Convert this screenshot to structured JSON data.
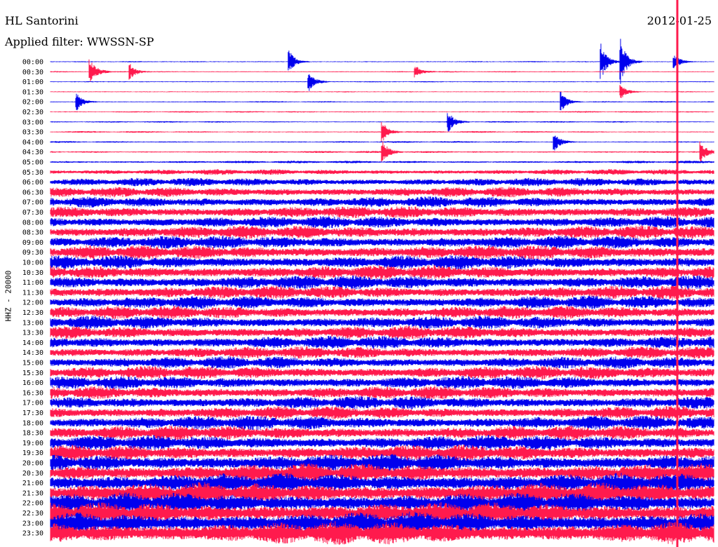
{
  "header": {
    "station": "HL Santorini",
    "filter": "Applied filter: WWSSN-SP",
    "date": "2012-01-25"
  },
  "chart_data": {
    "type": "line",
    "title": "HL Santorini",
    "date": "2012-01-25",
    "filter": "WWSSN-SP",
    "ylabel": "HHZ - 20000",
    "row_labels": [
      "00:00",
      "00:30",
      "01:00",
      "01:30",
      "02:00",
      "02:30",
      "03:00",
      "03:30",
      "04:00",
      "04:30",
      "05:00",
      "05:30",
      "06:00",
      "06:30",
      "07:00",
      "07:30",
      "08:00",
      "08:30",
      "09:00",
      "09:30",
      "10:00",
      "10:30",
      "11:00",
      "11:30",
      "12:00",
      "12:30",
      "13:00",
      "13:30",
      "14:00",
      "14:30",
      "15:00",
      "15:30",
      "16:00",
      "16:30",
      "17:00",
      "17:30",
      "18:00",
      "18:30",
      "19:00",
      "19:30",
      "20:00",
      "20:30",
      "21:00",
      "21:30",
      "22:00",
      "22:30",
      "23:00",
      "23:30"
    ],
    "series_colors": [
      "#0000ee",
      "#ff1a4d"
    ],
    "noise_level": [
      0.06,
      0.07,
      0.06,
      0.06,
      0.07,
      0.08,
      0.08,
      0.09,
      0.09,
      0.11,
      0.14,
      0.3,
      0.45,
      0.55,
      0.6,
      0.65,
      0.65,
      0.7,
      0.7,
      0.75,
      0.75,
      0.75,
      0.75,
      0.7,
      0.7,
      0.7,
      0.7,
      0.7,
      0.7,
      0.65,
      0.65,
      0.7,
      0.7,
      0.7,
      0.7,
      0.7,
      0.75,
      0.75,
      0.8,
      0.85,
      0.95,
      1.0,
      1.05,
      1.1,
      1.1,
      1.15,
      1.2,
      1.25
    ],
    "events": [
      {
        "row": 0,
        "pos": 0.36,
        "amp": 1.6
      },
      {
        "row": 0,
        "pos": 0.83,
        "amp": 2.6
      },
      {
        "row": 0,
        "pos": 0.86,
        "amp": 3.2
      },
      {
        "row": 0,
        "pos": 0.94,
        "amp": 1.2
      },
      {
        "row": 1,
        "pos": 0.06,
        "amp": 1.8
      },
      {
        "row": 1,
        "pos": 0.12,
        "amp": 1.1
      },
      {
        "row": 1,
        "pos": 0.55,
        "amp": 0.9
      },
      {
        "row": 2,
        "pos": 0.39,
        "amp": 1.3
      },
      {
        "row": 3,
        "pos": 0.86,
        "amp": 1.0
      },
      {
        "row": 4,
        "pos": 0.04,
        "amp": 1.2
      },
      {
        "row": 4,
        "pos": 0.77,
        "amp": 1.4
      },
      {
        "row": 6,
        "pos": 0.6,
        "amp": 1.4
      },
      {
        "row": 7,
        "pos": 0.5,
        "amp": 1.5
      },
      {
        "row": 8,
        "pos": 0.76,
        "amp": 1.2
      },
      {
        "row": 9,
        "pos": 0.5,
        "amp": 1.6
      },
      {
        "row": 9,
        "pos": 0.98,
        "amp": 1.4
      }
    ],
    "long_event": {
      "pos": 0.945,
      "from_row": 0,
      "to_row": 47
    }
  }
}
